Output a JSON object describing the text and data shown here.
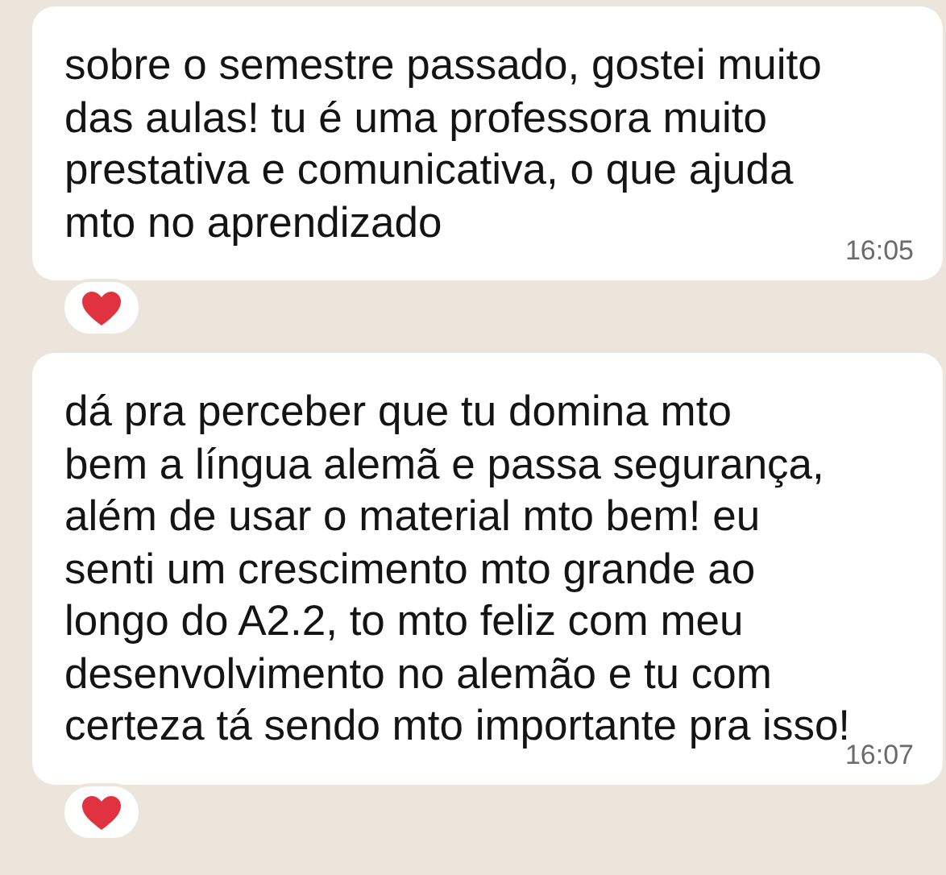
{
  "messages": [
    {
      "text": "sobre o semestre passado, gostei muito\ndas aulas! tu é uma professora muito\nprestativa e comunicativa, o que ajuda\nmto no aprendizado",
      "time": "16:05",
      "heart_reaction": true
    },
    {
      "text": "dá pra perceber que tu domina mto\nbem a língua alemã e passa segurança,\nalém de usar o material mto bem! eu\nsenti um crescimento mto grande ao\nlongo do A2.2, to mto feliz com meu\ndesenvolvimento no alemão e tu com\ncerteza tá sendo mto importante pra isso!",
      "time": "16:07",
      "heart_reaction": true
    }
  ]
}
